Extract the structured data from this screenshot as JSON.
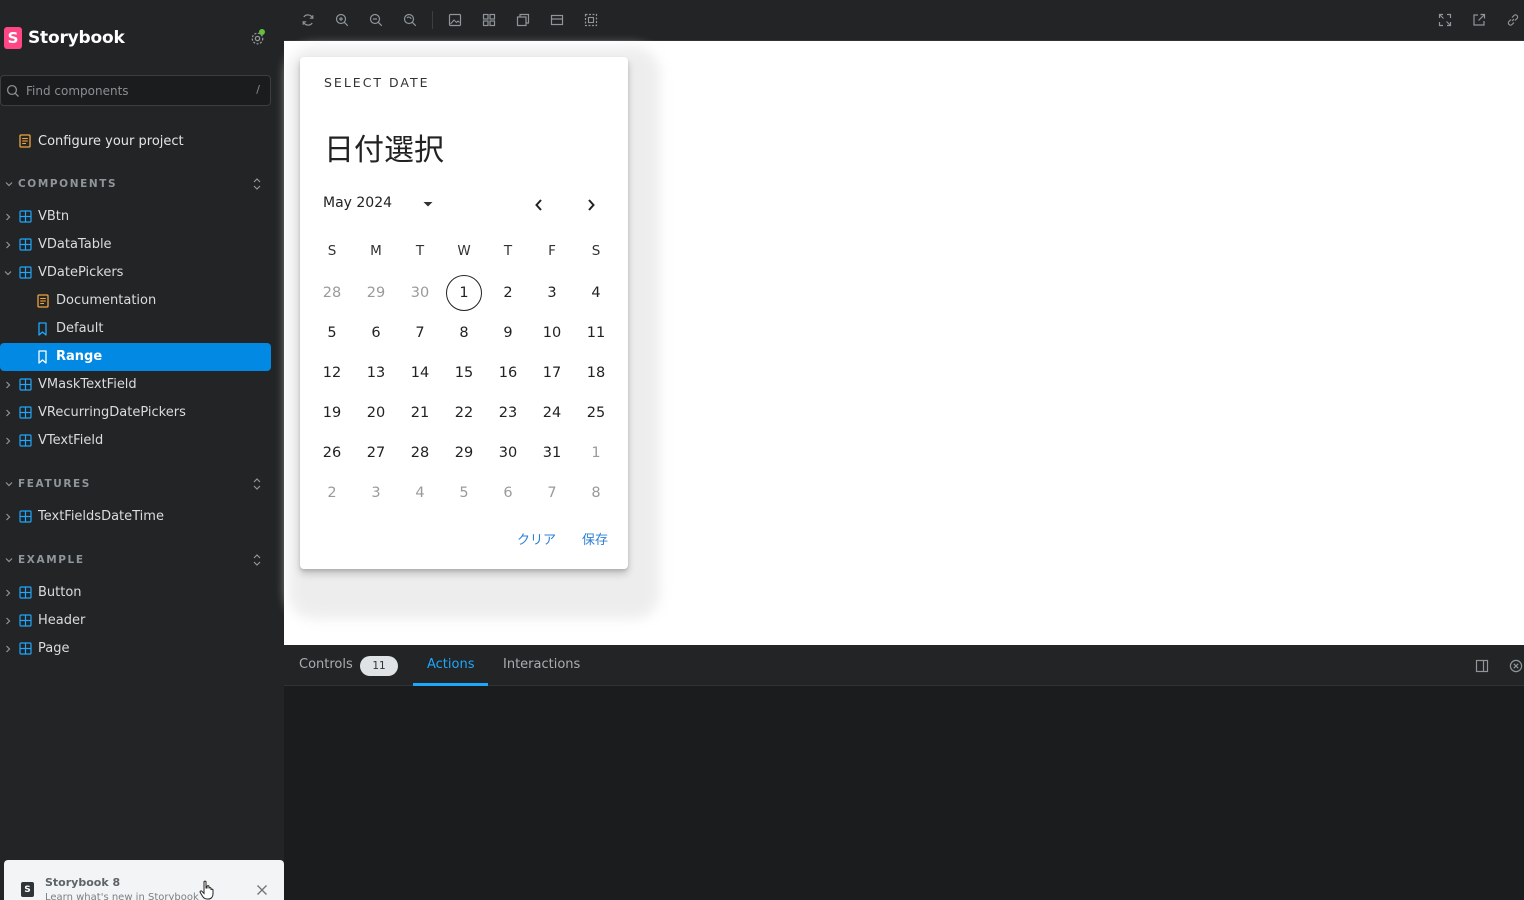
{
  "sidebar": {
    "brand": "Storybook",
    "logo_letter": "S",
    "search_placeholder": "Find components",
    "search_shortcut": "/",
    "configure_label": "Configure your project",
    "sections": {
      "components": {
        "title": "COMPONENTS"
      },
      "features": {
        "title": "FEATURES"
      },
      "example": {
        "title": "EXAMPLE"
      }
    },
    "items": {
      "vbtn": "VBtn",
      "vdatatable": "VDataTable",
      "vdatepickers": "VDatePickers",
      "documentation": "Documentation",
      "default": "Default",
      "range": "Range",
      "vmasktextfield": "VMaskTextField",
      "vrecurringdatepickers": "VRecurringDatePickers",
      "vtextfield": "VTextField",
      "textfieldsdatetime": "TextFieldsDateTime",
      "button": "Button",
      "header": "Header",
      "page": "Page"
    },
    "toast": {
      "title": "Storybook 8",
      "subtitle": "Learn what's new in Storybook"
    }
  },
  "picker": {
    "subtitle": "SELECT DATE",
    "heading": "日付選択",
    "month_label": "May 2024",
    "weekdays": [
      "S",
      "M",
      "T",
      "W",
      "T",
      "F",
      "S"
    ],
    "weeks": [
      [
        "28",
        "29",
        "30",
        "1",
        "2",
        "3",
        "4"
      ],
      [
        "5",
        "6",
        "7",
        "8",
        "9",
        "10",
        "11"
      ],
      [
        "12",
        "13",
        "14",
        "15",
        "16",
        "17",
        "18"
      ],
      [
        "19",
        "20",
        "21",
        "22",
        "23",
        "24",
        "25"
      ],
      [
        "26",
        "27",
        "28",
        "29",
        "30",
        "31",
        "1"
      ],
      [
        "2",
        "3",
        "4",
        "5",
        "6",
        "7",
        "8"
      ]
    ],
    "actions": {
      "clear": "クリア",
      "save": "保存"
    }
  },
  "panel": {
    "tabs": {
      "controls": "Controls",
      "actions": "Actions",
      "interactions": "Interactions"
    },
    "controls_count": "11"
  },
  "colors": {
    "accent": "#1ea7fd",
    "selected_bg": "#0289e3",
    "brand": "#ff4785",
    "story_icon": "#1ea7fd",
    "doc_icon": "#f1a33d"
  }
}
